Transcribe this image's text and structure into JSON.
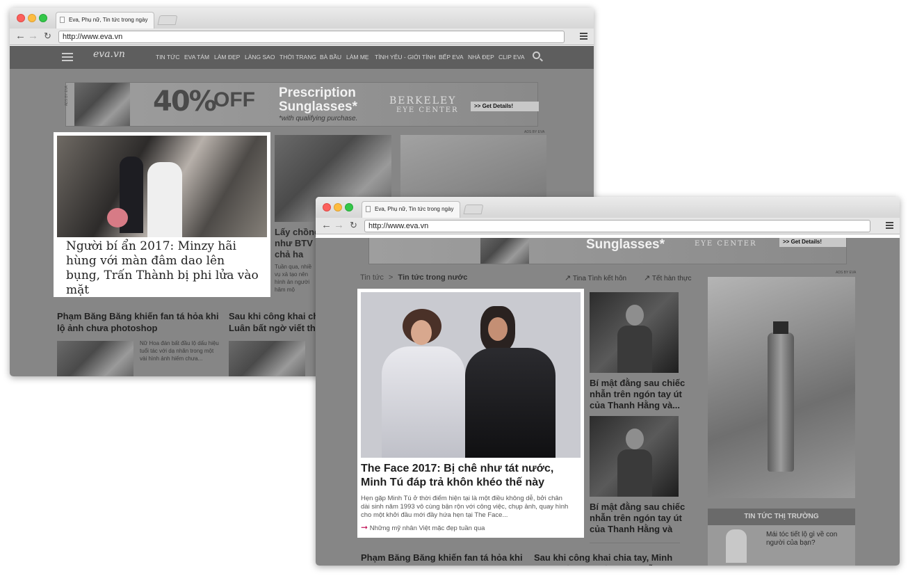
{
  "back_window": {
    "tab_title": "Eva, Phụ nữ, Tin tức trong ngày",
    "url": "http://www.eva.vn",
    "logo": "eva.vn",
    "nav_items": [
      "TIN TỨC",
      "EVA TÁM",
      "LÀM ĐẸP",
      "LÀNG SAO",
      "THỜI TRANG",
      "BÀ BẦU",
      "LÀM MẸ",
      "TÌNH YÊU - GIỚI TÍNH",
      "BẾP EVA",
      "NHÀ ĐẸP",
      "CLIP EVA"
    ],
    "ad": {
      "side_label": "ADS BY EVA",
      "percent": "40%",
      "off": "OFF",
      "line1": "Prescription",
      "line2": "Sunglasses*",
      "note": "*with qualifying purchase.",
      "brand1": "BERKELEY",
      "brand2": "EYE CENTER",
      "cta": ">> Get Details!"
    },
    "ads_label": "ADS BY EVA",
    "featured_title": "Người bí ẩn 2017: Minzy hãi hùng với màn đâm dao lên bụng, Trấn Thành bị phi lửa vào mặt",
    "mid_title": "Lấy chồng như BTV ai chả ha",
    "mid_desc": "Tuần qua, nhiề vụ xả tạo nên hình ản người hâm mộ",
    "story1_title": "Phạm Băng Băng khiến fan tá hỏa khi lộ ảnh chưa photoshop",
    "story1_desc": "Nữ Hoa đán bất đầu lộ dấu hiệu tuổi tác với dạ nhăn trong một vài hình ảnh hiếm chưa...",
    "story2_title": "Sau khi công khai ch Luân bất ngờ viết th"
  },
  "front_window": {
    "tab_title": "Eva, Phụ nữ, Tin tức trong ngày",
    "url": "http://www.eva.vn",
    "ad_line2": "Sunglasses*",
    "ad_brand": "EYE CENTER",
    "ad_cta": ">> Get Details!",
    "breadcrumb": {
      "parent": "Tin tức",
      "separator": ">",
      "current": "Tin tức trong nước"
    },
    "trends": [
      "Tina Tình kết hôn",
      "Tết hàn thực"
    ],
    "ads_label": "ADS BY EVA",
    "featured": {
      "title": "The Face 2017: Bị chê như tát nước, Minh Tú đáp trả khôn khéo thế này",
      "desc": "Hẹn gặp Minh Tú ở thời điểm hiện tại là một điều không dễ, bởi chân dài sinh năm 1993 vô cùng bận rộn với công việc, chụp ảnh, quay hình cho một khởi đầu mới đầy hứa hẹn tại The Face...",
      "related": "Những mỹ nhân Việt mặc đẹp tuần qua"
    },
    "side_stories": [
      {
        "title": "Bí mật đằng sau chiếc nhẫn trên ngón tay út của Thanh Hằng và..."
      },
      {
        "title": "Bí mật đằng sau chiếc nhẫn trên ngón tay út của Thanh Hằng và"
      }
    ],
    "market": {
      "header": "TIN TỨC THỊ TRƯỜNG",
      "item": "Mái tóc tiết lộ gì về con người của bạn?"
    },
    "bottom_stories": [
      "Phạm Băng Băng khiến fan tá hỏa khi lộ ảnh chưa photoshop",
      "Sau khi công khai chia tay, Minh Luân bất ngờ viết thư xin lỗi"
    ]
  },
  "colors": {
    "highlight": "#ffffff",
    "dim_overlay": "#868686",
    "accent_pink": "#c2185b"
  }
}
